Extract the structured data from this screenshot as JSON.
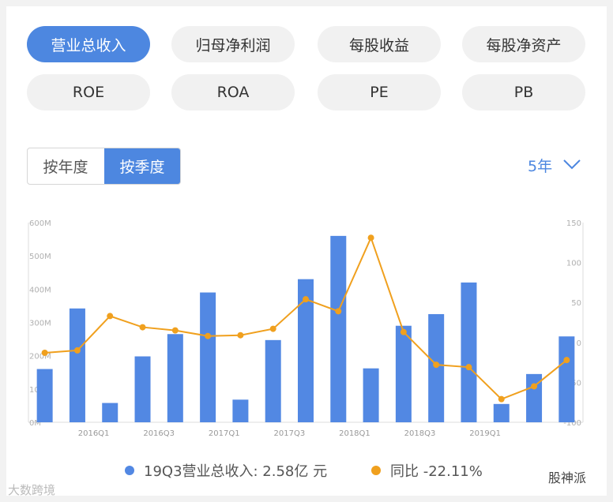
{
  "tabs": [
    {
      "label": "营业总收入",
      "active": true
    },
    {
      "label": "归母净利润",
      "active": false
    },
    {
      "label": "每股收益",
      "active": false
    },
    {
      "label": "每股净资产",
      "active": false
    },
    {
      "label": "ROE",
      "active": false
    },
    {
      "label": "ROA",
      "active": false
    },
    {
      "label": "PE",
      "active": false
    },
    {
      "label": "PB",
      "active": false
    }
  ],
  "period_toggle": {
    "annual": "按年度",
    "quarterly": "按季度",
    "selected": "quarterly"
  },
  "range_selector": {
    "label": "5年",
    "icon": "chevron-down-icon"
  },
  "colors": {
    "accent": "#4d87e0",
    "bar": "#5288e3",
    "line": "#f0a01e"
  },
  "chart_data": {
    "type": "bar+line",
    "x": [
      "2015Q3",
      "2015Q4",
      "2016Q1",
      "2016Q2",
      "2016Q3",
      "2016Q4",
      "2017Q1",
      "2017Q2",
      "2017Q3",
      "2017Q4",
      "2018Q1",
      "2018Q2",
      "2018Q3",
      "2018Q4",
      "2019Q1",
      "2019Q2",
      "2019Q3"
    ],
    "x_tick_labels": [
      "2016Q1",
      "2016Q3",
      "2017Q1",
      "2017Q3",
      "2018Q1",
      "2018Q3",
      "2019Q1"
    ],
    "series": [
      {
        "name": "营业总收入",
        "axis": "left",
        "type": "bar",
        "values": [
          160,
          342,
          58,
          198,
          265,
          390,
          68,
          247,
          430,
          560,
          162,
          290,
          325,
          420,
          55,
          145,
          258
        ]
      },
      {
        "name": "同比",
        "axis": "right",
        "type": "line",
        "values": [
          -13,
          -10,
          33,
          19,
          15,
          8,
          9,
          17,
          54,
          39,
          131,
          13,
          -28,
          -31,
          -71,
          -55,
          -22.11
        ]
      }
    ],
    "left_axis": {
      "ylim": [
        0,
        600
      ],
      "ticks": [
        "0M",
        "100M",
        "200M",
        "300M",
        "400M",
        "500M",
        "600M"
      ]
    },
    "right_axis": {
      "ylim": [
        -100,
        150
      ],
      "ticks": [
        "-100",
        "-50",
        "0",
        "50",
        "100",
        "150"
      ]
    },
    "grid": false
  },
  "legend": {
    "revenue": "19Q3营业总收入: 2.58亿 元",
    "yoy": "同比 -22.11%"
  },
  "watermark_left": "大数跨境",
  "watermark_right": "股神派"
}
